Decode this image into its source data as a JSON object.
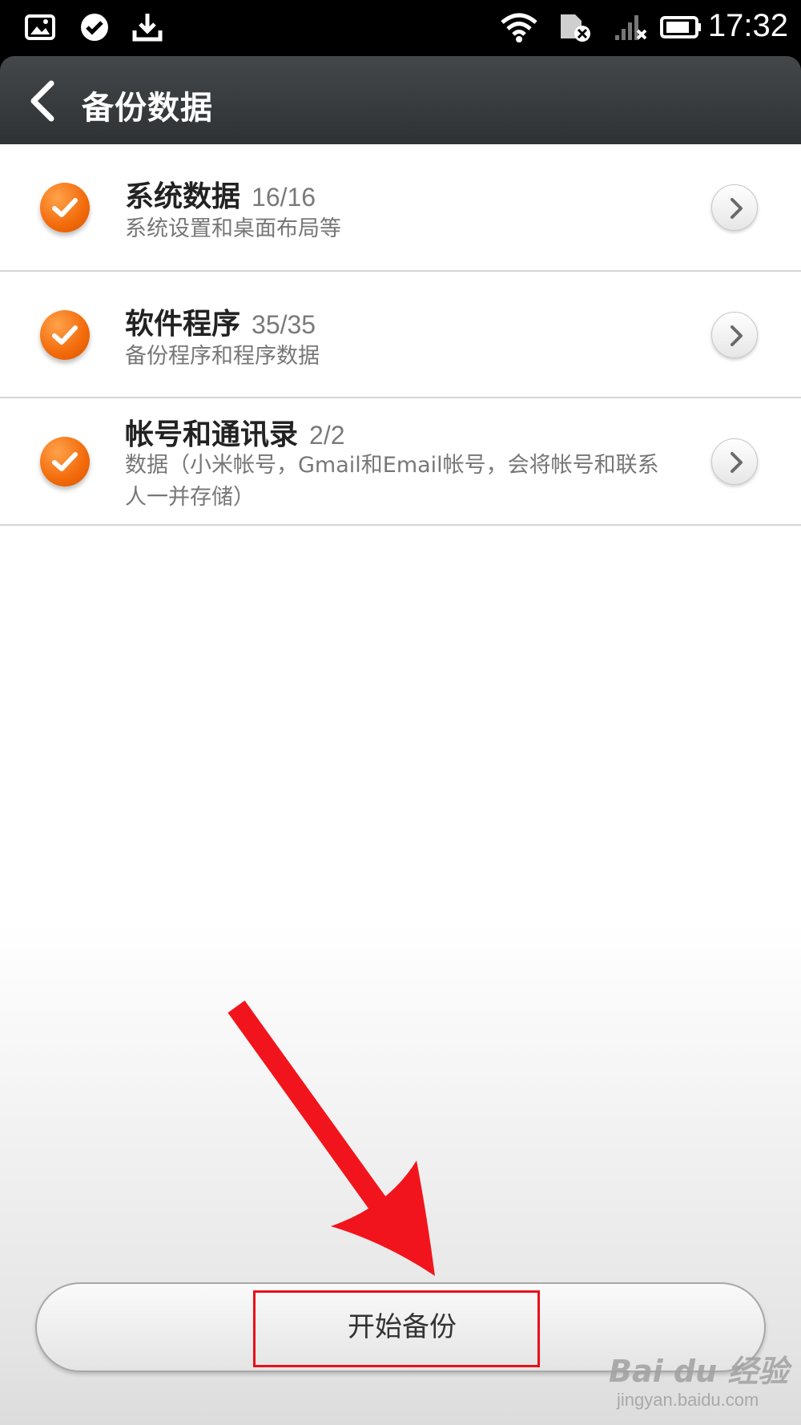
{
  "status_bar": {
    "time": "17:32",
    "icons": [
      "gallery-icon",
      "check-circle-icon",
      "download-icon",
      "wifi-icon",
      "sim-off-icon",
      "signal-off-icon",
      "battery-icon"
    ]
  },
  "header": {
    "title": "备份数据",
    "back_icon": "back-chevron-icon"
  },
  "items": [
    {
      "title": "系统数据",
      "count": "16/16",
      "subtitle": "系统设置和桌面布局等",
      "checked": true
    },
    {
      "title": "软件程序",
      "count": "35/35",
      "subtitle": "备份程序和程序数据",
      "checked": true
    },
    {
      "title": "帐号和通讯录",
      "count": "2/2",
      "subtitle": "数据（小米帐号，Gmail和Email帐号，会将帐号和联系人一并存储）",
      "checked": true
    }
  ],
  "start_button": {
    "label": "开始备份"
  },
  "watermark": {
    "logo": "Bai du 经验",
    "url": "jingyan.baidu.com"
  },
  "colors": {
    "accent": "#f26a0a",
    "annotation": "#e8101a",
    "header": "#383b3d"
  }
}
